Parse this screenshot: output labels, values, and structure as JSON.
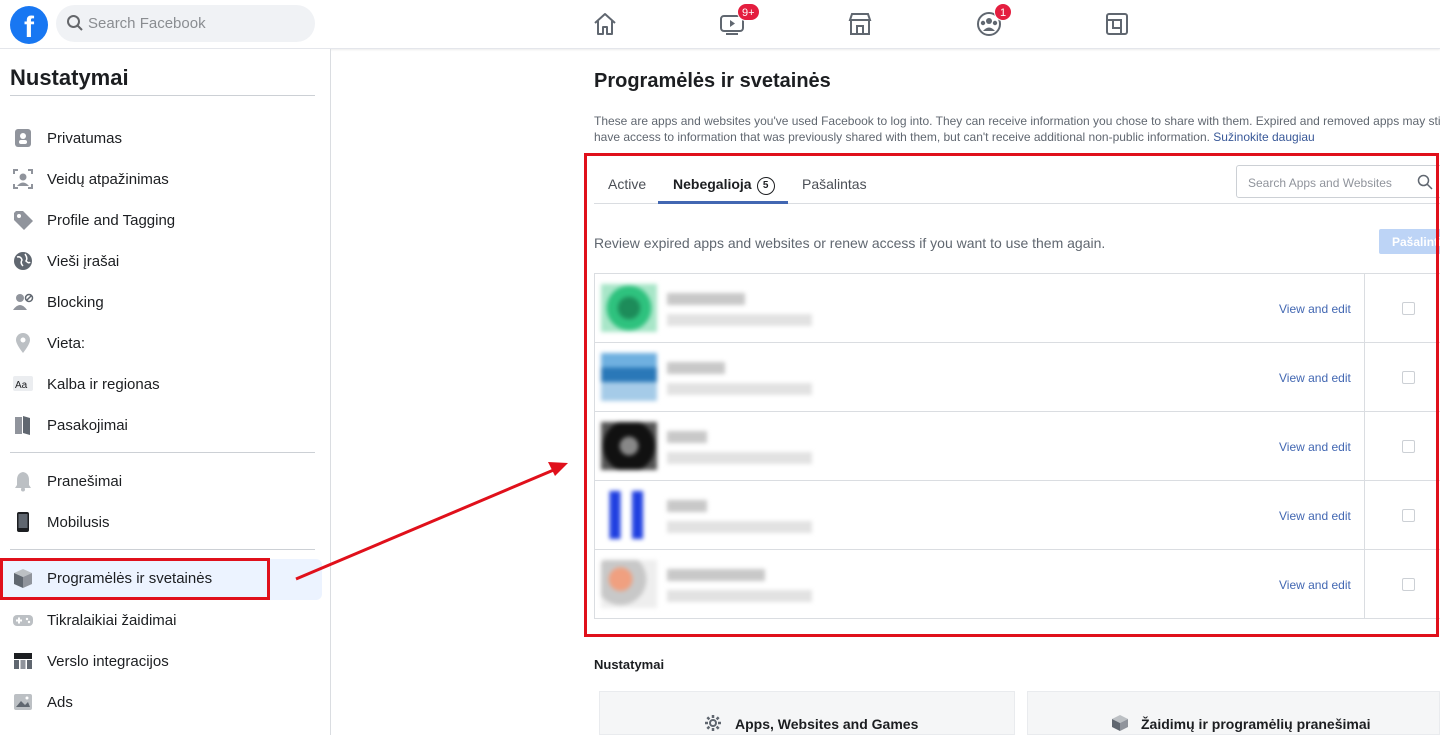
{
  "header": {
    "logo": "f",
    "search_placeholder": "Search Facebook",
    "video_badge": "9+",
    "groups_badge": "1",
    "nav_icons": [
      "home-icon",
      "watch-icon",
      "marketplace-icon",
      "groups-icon",
      "gaming-icon"
    ]
  },
  "sidebar": {
    "title": "Nustatymai",
    "items": [
      {
        "label": "Privatumas",
        "icon": "privacy-lock-icon"
      },
      {
        "label": "Veidų atpažinimas",
        "icon": "face-recognition-icon"
      },
      {
        "label": "Profile and Tagging",
        "icon": "tag-icon"
      },
      {
        "label": "Vieši įrašai",
        "icon": "globe-icon"
      },
      {
        "label": "Blocking",
        "icon": "blocking-icon"
      },
      {
        "label": "Vieta:",
        "icon": "location-pin-icon"
      },
      {
        "label": "Kalba ir regionas",
        "icon": "language-icon"
      },
      {
        "label": "Pasakojimai",
        "icon": "stories-book-icon"
      },
      {
        "label": "Pranešimai",
        "icon": "bell-icon"
      },
      {
        "label": "Mobilusis",
        "icon": "mobile-phone-icon"
      },
      {
        "label": "Programėlės ir svetainės",
        "icon": "cube-icon"
      },
      {
        "label": "Tikralaikiai žaidimai",
        "icon": "game-controller-icon"
      },
      {
        "label": "Verslo integracijos",
        "icon": "business-integration-icon"
      },
      {
        "label": "Ads",
        "icon": "ads-icon"
      }
    ],
    "active_item": "Programėlės ir svetainės"
  },
  "main": {
    "title": "Programėlės ir svetainės",
    "description_line1": "These are apps and websites you've used Facebook to log into. They can receive information you chose to share with them. Expired and removed apps may still",
    "description_line2": "have access to information that was previously shared with them, but can't receive additional non-public information.",
    "learn_more": "Sužinokite daugiau",
    "tabs": [
      {
        "label": "Active"
      },
      {
        "label": "Nebegalioja",
        "count": "5"
      },
      {
        "label": "Pašalintas"
      }
    ],
    "active_tab": "Nebegalioja",
    "search_placeholder": "Search Apps and Websites",
    "review_text": "Review expired apps and websites or renew access if you want to use them again.",
    "remove_button": "Pašalinti",
    "apps": [
      {
        "action": "View and edit",
        "thumb_color": "#2ec27e"
      },
      {
        "action": "View and edit",
        "thumb_color": "#4a90c8"
      },
      {
        "action": "View and edit",
        "thumb_color": "#222222"
      },
      {
        "action": "View and edit",
        "thumb_color": "#2040e0"
      },
      {
        "action": "View and edit",
        "thumb_color": "#e8a080"
      }
    ],
    "settings_title": "Nustatymai",
    "settings_cards": [
      {
        "label": "Apps, Websites and Games",
        "icon": "gear-icon"
      },
      {
        "label": "Žaidimų ir programėlių pranešimai",
        "icon": "cube-icon"
      }
    ]
  },
  "colors": {
    "brand": "#1877f2",
    "highlight": "#e0101b",
    "link": "#4267b2"
  }
}
